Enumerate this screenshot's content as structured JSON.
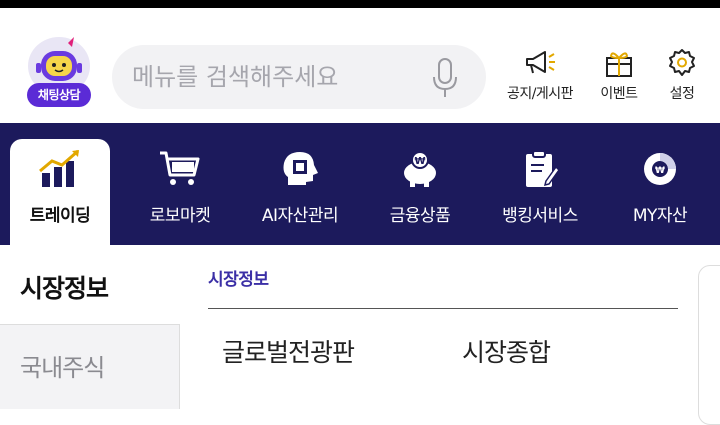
{
  "header": {
    "chatbot_label": "채팅상담",
    "search": {
      "placeholder": "메뉴를 검색해주세요",
      "value": ""
    },
    "icons": [
      {
        "id": "notice",
        "label": "공지/게시판",
        "icon": "megaphone-icon"
      },
      {
        "id": "event",
        "label": "이벤트",
        "icon": "gift-icon"
      },
      {
        "id": "settings",
        "label": "설정",
        "icon": "gear-icon"
      }
    ]
  },
  "nav": {
    "items": [
      {
        "label": "트레이딩",
        "icon": "chart-up-icon",
        "active": true
      },
      {
        "label": "로보마켓",
        "icon": "cart-icon",
        "active": false
      },
      {
        "label": "AI자산관리",
        "icon": "ai-head-icon",
        "active": false
      },
      {
        "label": "금융상품",
        "icon": "piggy-bank-icon",
        "active": false
      },
      {
        "label": "뱅킹서비스",
        "icon": "clipboard-pen-icon",
        "active": false
      },
      {
        "label": "MY자산",
        "icon": "donut-chart-icon",
        "active": false
      }
    ]
  },
  "content": {
    "sidebar_title": "시장정보",
    "sidebar_items": [
      {
        "label": "국내주식"
      }
    ],
    "breadcrumb": "시장정보",
    "tabs": [
      {
        "label": "글로벌전광판"
      },
      {
        "label": "시장종합"
      }
    ]
  },
  "colors": {
    "nav_bg": "#1c1a5c",
    "accent": "#3b2fa6",
    "badge": "#5b2bd6"
  }
}
